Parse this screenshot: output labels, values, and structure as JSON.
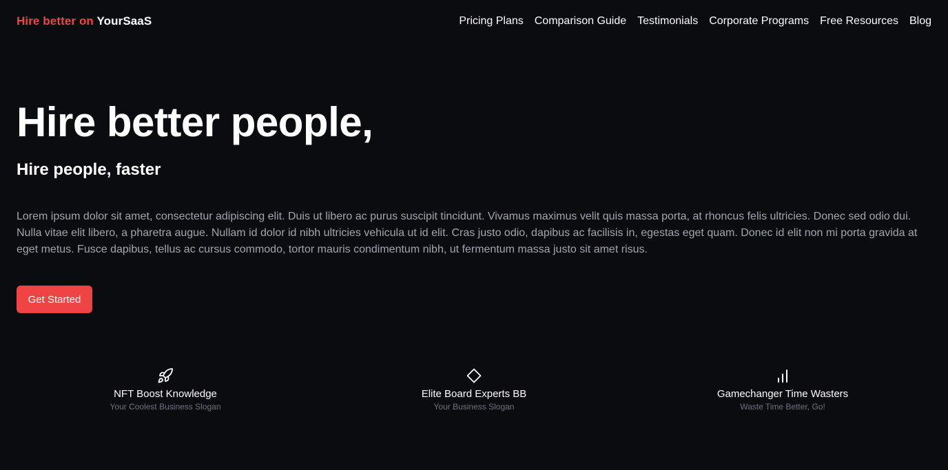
{
  "header": {
    "brand_accent": "Hire better on",
    "brand_name": "YourSaaS",
    "nav": [
      {
        "label": "Pricing Plans"
      },
      {
        "label": "Comparison Guide"
      },
      {
        "label": "Testimonials"
      },
      {
        "label": "Corporate Programs"
      },
      {
        "label": "Free Resources"
      },
      {
        "label": "Blog"
      }
    ]
  },
  "hero": {
    "title": "Hire better people,",
    "subtitle": "Hire people, faster",
    "body": "Lorem ipsum dolor sit amet, consectetur adipiscing elit. Duis ut libero ac purus suscipit tincidunt. Vivamus maximus velit quis massa porta, at rhoncus felis ultricies. Donec sed odio dui. Nulla vitae elit libero, a pharetra augue. Nullam id dolor id nibh ultricies vehicula ut id elit. Cras justo odio, dapibus ac facilisis in, egestas eget quam. Donec id elit non mi porta gravida at eget metus. Fusce dapibus, tellus ac cursus commodo, tortor mauris condimentum nibh, ut fermentum massa justo sit amet risus.",
    "cta_label": "Get Started"
  },
  "features": [
    {
      "icon": "rocket-icon",
      "title": "NFT Boost Knowledge",
      "slogan": "Your Coolest Business Slogan"
    },
    {
      "icon": "diamond-icon",
      "title": "Elite Board Experts BB",
      "slogan": "Your Business Slogan"
    },
    {
      "icon": "bar-chart-icon",
      "title": "Gamechanger Time Wasters",
      "slogan": "Waste Time Better, Go!"
    }
  ],
  "colors": {
    "background": "#0b0c10",
    "accent": "#ef4444",
    "body_text": "#a1a5ae",
    "muted_text": "#6b7280"
  }
}
